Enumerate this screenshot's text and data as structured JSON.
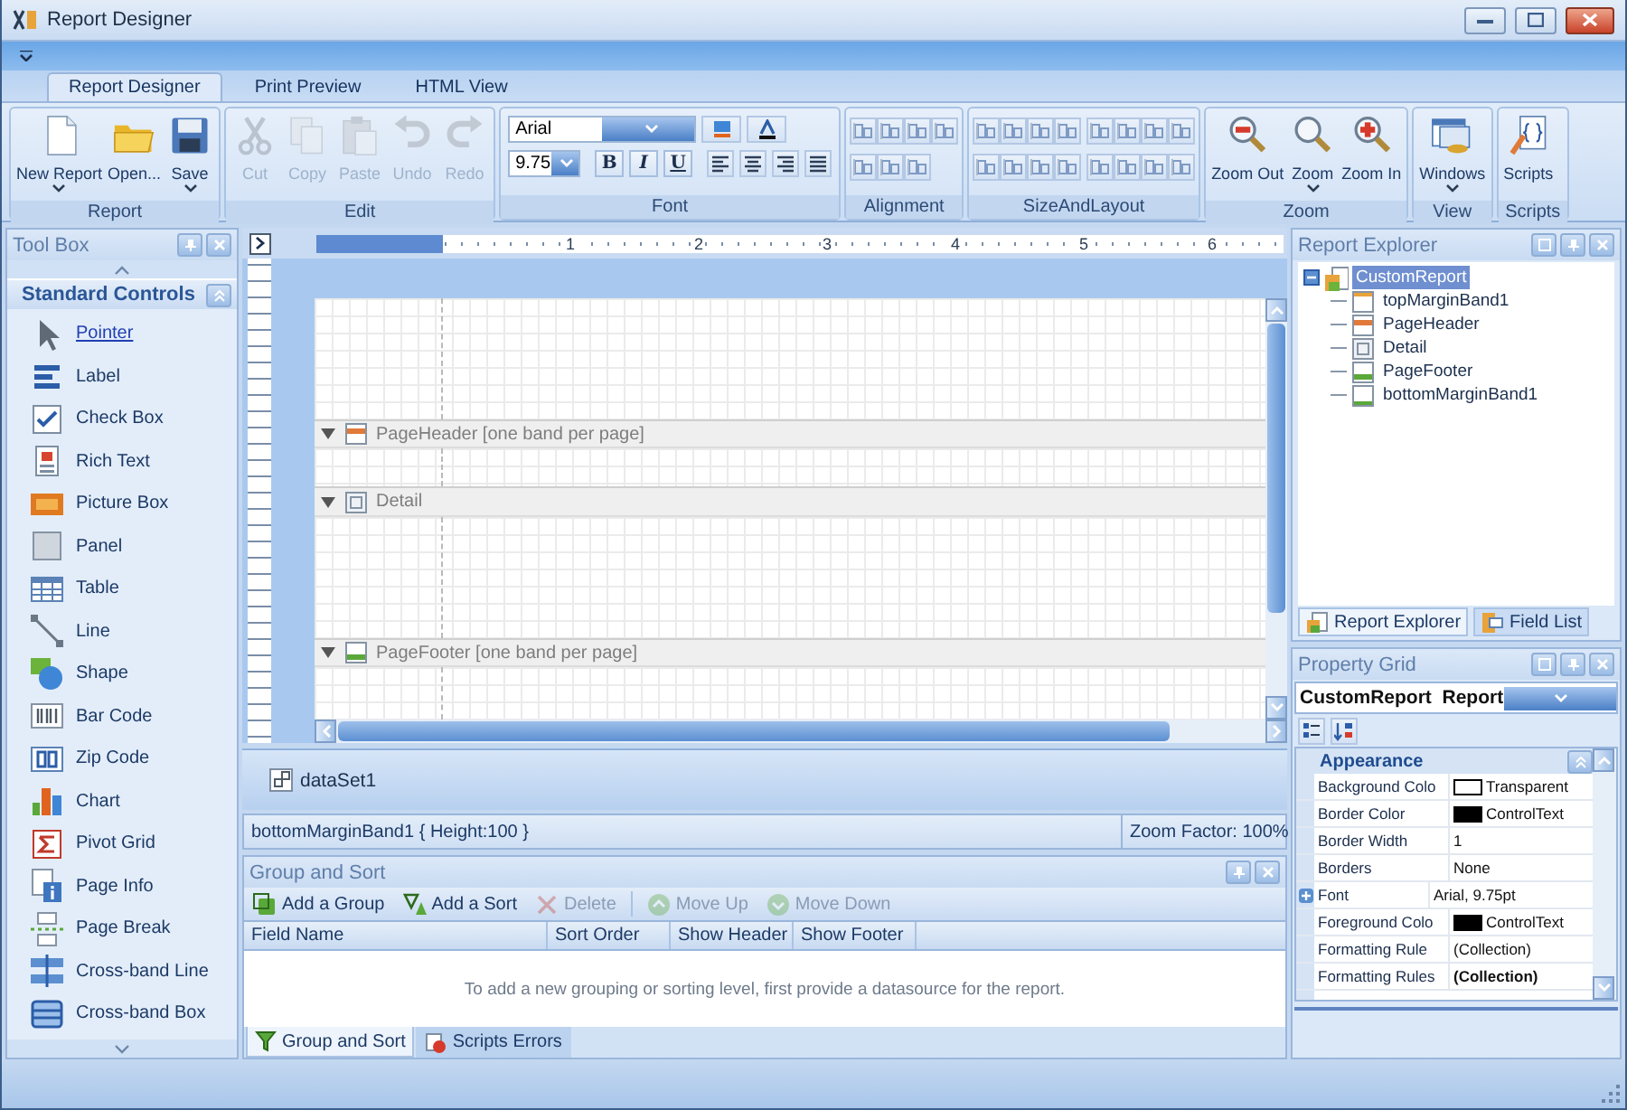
{
  "window": {
    "title": "Report Designer"
  },
  "ribbon_tabs": [
    {
      "label": "Report Designer",
      "selected": true
    },
    {
      "label": "Print Preview",
      "selected": false
    },
    {
      "label": "HTML View",
      "selected": false
    }
  ],
  "ribbon_groups": [
    {
      "label": "Report",
      "kind": "large",
      "buttons": [
        {
          "label": "New Report",
          "dropdown": true,
          "disabled": false
        },
        {
          "label": "Open...",
          "dropdown": false,
          "disabled": false
        },
        {
          "label": "Save",
          "dropdown": true,
          "disabled": false
        }
      ]
    },
    {
      "label": "Edit",
      "kind": "large",
      "buttons": [
        {
          "label": "Cut",
          "dropdown": false,
          "disabled": true
        },
        {
          "label": "Copy",
          "dropdown": false,
          "disabled": true
        },
        {
          "label": "Paste",
          "dropdown": false,
          "disabled": true
        },
        {
          "label": "Undo",
          "dropdown": false,
          "disabled": true
        },
        {
          "label": "Redo",
          "dropdown": false,
          "disabled": true
        }
      ]
    },
    {
      "label": "Font",
      "kind": "font",
      "font_name": "Arial",
      "font_size": "9.75",
      "styles": [
        "B",
        "I",
        "U"
      ]
    },
    {
      "label": "Alignment",
      "kind": "alignment"
    },
    {
      "label": "SizeAndLayout",
      "kind": "size-and-layout"
    },
    {
      "label": "Zoom",
      "kind": "large",
      "buttons": [
        {
          "label": "Zoom Out",
          "dropdown": false,
          "disabled": false
        },
        {
          "label": "Zoom",
          "dropdown": true,
          "disabled": false
        },
        {
          "label": "Zoom In",
          "dropdown": false,
          "disabled": false
        }
      ]
    },
    {
      "label": "View",
      "kind": "large",
      "buttons": [
        {
          "label": "Windows",
          "dropdown": true,
          "disabled": false
        }
      ]
    },
    {
      "label": "Scripts",
      "kind": "large",
      "buttons": [
        {
          "label": "Scripts",
          "dropdown": false,
          "disabled": false
        }
      ]
    }
  ],
  "toolbox": {
    "title": "Tool Box",
    "section": "Standard Controls",
    "items": [
      {
        "label": "Pointer",
        "selected": true
      },
      {
        "label": "Label",
        "selected": false
      },
      {
        "label": "Check Box",
        "selected": false
      },
      {
        "label": "Rich Text",
        "selected": false
      },
      {
        "label": "Picture Box",
        "selected": false
      },
      {
        "label": "Panel",
        "selected": false
      },
      {
        "label": "Table",
        "selected": false
      },
      {
        "label": "Line",
        "selected": false
      },
      {
        "label": "Shape",
        "selected": false
      },
      {
        "label": "Bar Code",
        "selected": false
      },
      {
        "label": "Zip Code",
        "selected": false
      },
      {
        "label": "Chart",
        "selected": false
      },
      {
        "label": "Pivot Grid",
        "selected": false
      },
      {
        "label": "Page Info",
        "selected": false
      },
      {
        "label": "Page Break",
        "selected": false
      },
      {
        "label": "Cross-band Line",
        "selected": false
      },
      {
        "label": "Cross-band Box",
        "selected": false
      }
    ]
  },
  "designer": {
    "ruler_labels": [
      "1",
      "2",
      "3",
      "4",
      "5",
      "6"
    ],
    "bands": [
      {
        "kind": "top-margin"
      },
      {
        "kind": "page-header",
        "label": "PageHeader [one band per page]",
        "expanded": true
      },
      {
        "kind": "detail",
        "label": "Detail",
        "expanded": true
      },
      {
        "kind": "page-footer",
        "label": "PageFooter [one band per page]",
        "expanded": true
      }
    ],
    "components": [
      "dataSet1"
    ],
    "status": {
      "selection": "bottomMarginBand1 { Height:100 }",
      "zoom": "Zoom Factor: 100%"
    }
  },
  "group_sort": {
    "title": "Group and Sort",
    "toolbar": [
      {
        "label": "Add a Group",
        "disabled": false
      },
      {
        "label": "Add a Sort",
        "disabled": false
      },
      {
        "label": "Delete",
        "disabled": true
      },
      {
        "label": "Move Up",
        "disabled": true
      },
      {
        "label": "Move Down",
        "disabled": true
      }
    ],
    "columns": [
      "Field Name",
      "Sort Order",
      "Show Header",
      "Show Footer"
    ],
    "empty_message": "To add a new grouping or sorting level, first provide a datasource for the report.",
    "tabs": [
      {
        "label": "Group and Sort",
        "selected": true
      },
      {
        "label": "Scripts Errors",
        "selected": false
      }
    ]
  },
  "report_explorer": {
    "title": "Report Explorer",
    "tree": [
      {
        "label": "CustomReport",
        "kind": "report",
        "selected": true,
        "expanded": true,
        "children": [
          {
            "label": "topMarginBand1",
            "kind": "top-margin",
            "selected": false
          },
          {
            "label": "PageHeader",
            "kind": "page-header",
            "selected": false
          },
          {
            "label": "Detail",
            "kind": "detail",
            "selected": false
          },
          {
            "label": "PageFooter",
            "kind": "page-footer",
            "selected": false
          },
          {
            "label": "bottomMarginBand1",
            "kind": "bottom-margin",
            "selected": false
          }
        ]
      }
    ],
    "tabs": [
      {
        "label": "Report Explorer",
        "selected": true
      },
      {
        "label": "Field List",
        "selected": false
      }
    ]
  },
  "property_grid": {
    "title": "Property Grid",
    "selected_object": "CustomReport  Report",
    "categories": [
      {
        "label": "Appearance",
        "expanded": true,
        "rows": [
          {
            "name": "Background Colo",
            "value": "Transparent",
            "color": "#ffffff",
            "kind": "simple",
            "bold": false
          },
          {
            "name": "Border Color",
            "value": "ControlText",
            "color": "#000000",
            "kind": "simple",
            "bold": false
          },
          {
            "name": "Border Width",
            "value": "1",
            "kind": "simple",
            "bold": false
          },
          {
            "name": "Borders",
            "value": "None",
            "kind": "simple",
            "bold": false
          },
          {
            "name": "Font",
            "value": "Arial, 9.75pt",
            "kind": "composite",
            "expanded": false,
            "bold": false
          },
          {
            "name": "Foreground Colo",
            "value": "ControlText",
            "color": "#000000",
            "kind": "simple",
            "bold": false
          },
          {
            "name": "Formatting Rule",
            "value": "(Collection)",
            "kind": "simple",
            "bold": false
          },
          {
            "name": "Formatting Rules",
            "value": "(Collection)",
            "kind": "simple",
            "bold": true
          }
        ]
      }
    ]
  }
}
